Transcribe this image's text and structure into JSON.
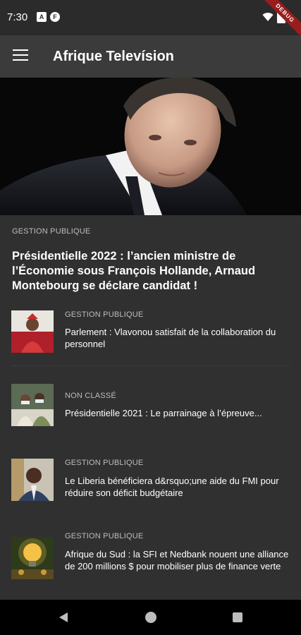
{
  "status_bar": {
    "time": "7:30",
    "icons": [
      "notification-a-icon",
      "notification-f-icon",
      "wifi-icon",
      "battery-icon"
    ],
    "debug_label": "DEBUG"
  },
  "app_bar": {
    "title": "Afrique Televísion",
    "menu_icon": "hamburger-menu-icon"
  },
  "featured": {
    "category": "GESTION PUBLIQUE",
    "title": "Présidentielle 2022 : l’ancien ministre de l’Économie sous François Hollande, Arnaud Montebourg se déclare candidat !"
  },
  "articles": [
    {
      "category": "GESTION PUBLIQUE",
      "title": "Parlement : Vlavonou satisfait de la collaboration du personnel"
    },
    {
      "category": "NON CLASSÉ",
      "title": "Présidentielle 2021 : Le parrainage à l’épreuve..."
    },
    {
      "category": "GESTION PUBLIQUE",
      "title": "Le Liberia bénéficiera d&rsquo;une aide du FMI pour réduire son déficit budgétaire"
    },
    {
      "category": "GESTION PUBLIQUE",
      "title": "Afrique du Sud : la SFI et Nedbank nouent une alliance de 200 millions $ pour mobiliser plus de finance verte"
    }
  ],
  "nav_bar": {
    "icons": [
      "back-icon",
      "home-icon",
      "recents-icon"
    ]
  },
  "colors": {
    "background": "#303030",
    "app_bar": "#3b3b3b",
    "status_bar": "#2b2b2b",
    "category_text": "#bdbdbd",
    "debug_ribbon": "#9b1c1c"
  }
}
